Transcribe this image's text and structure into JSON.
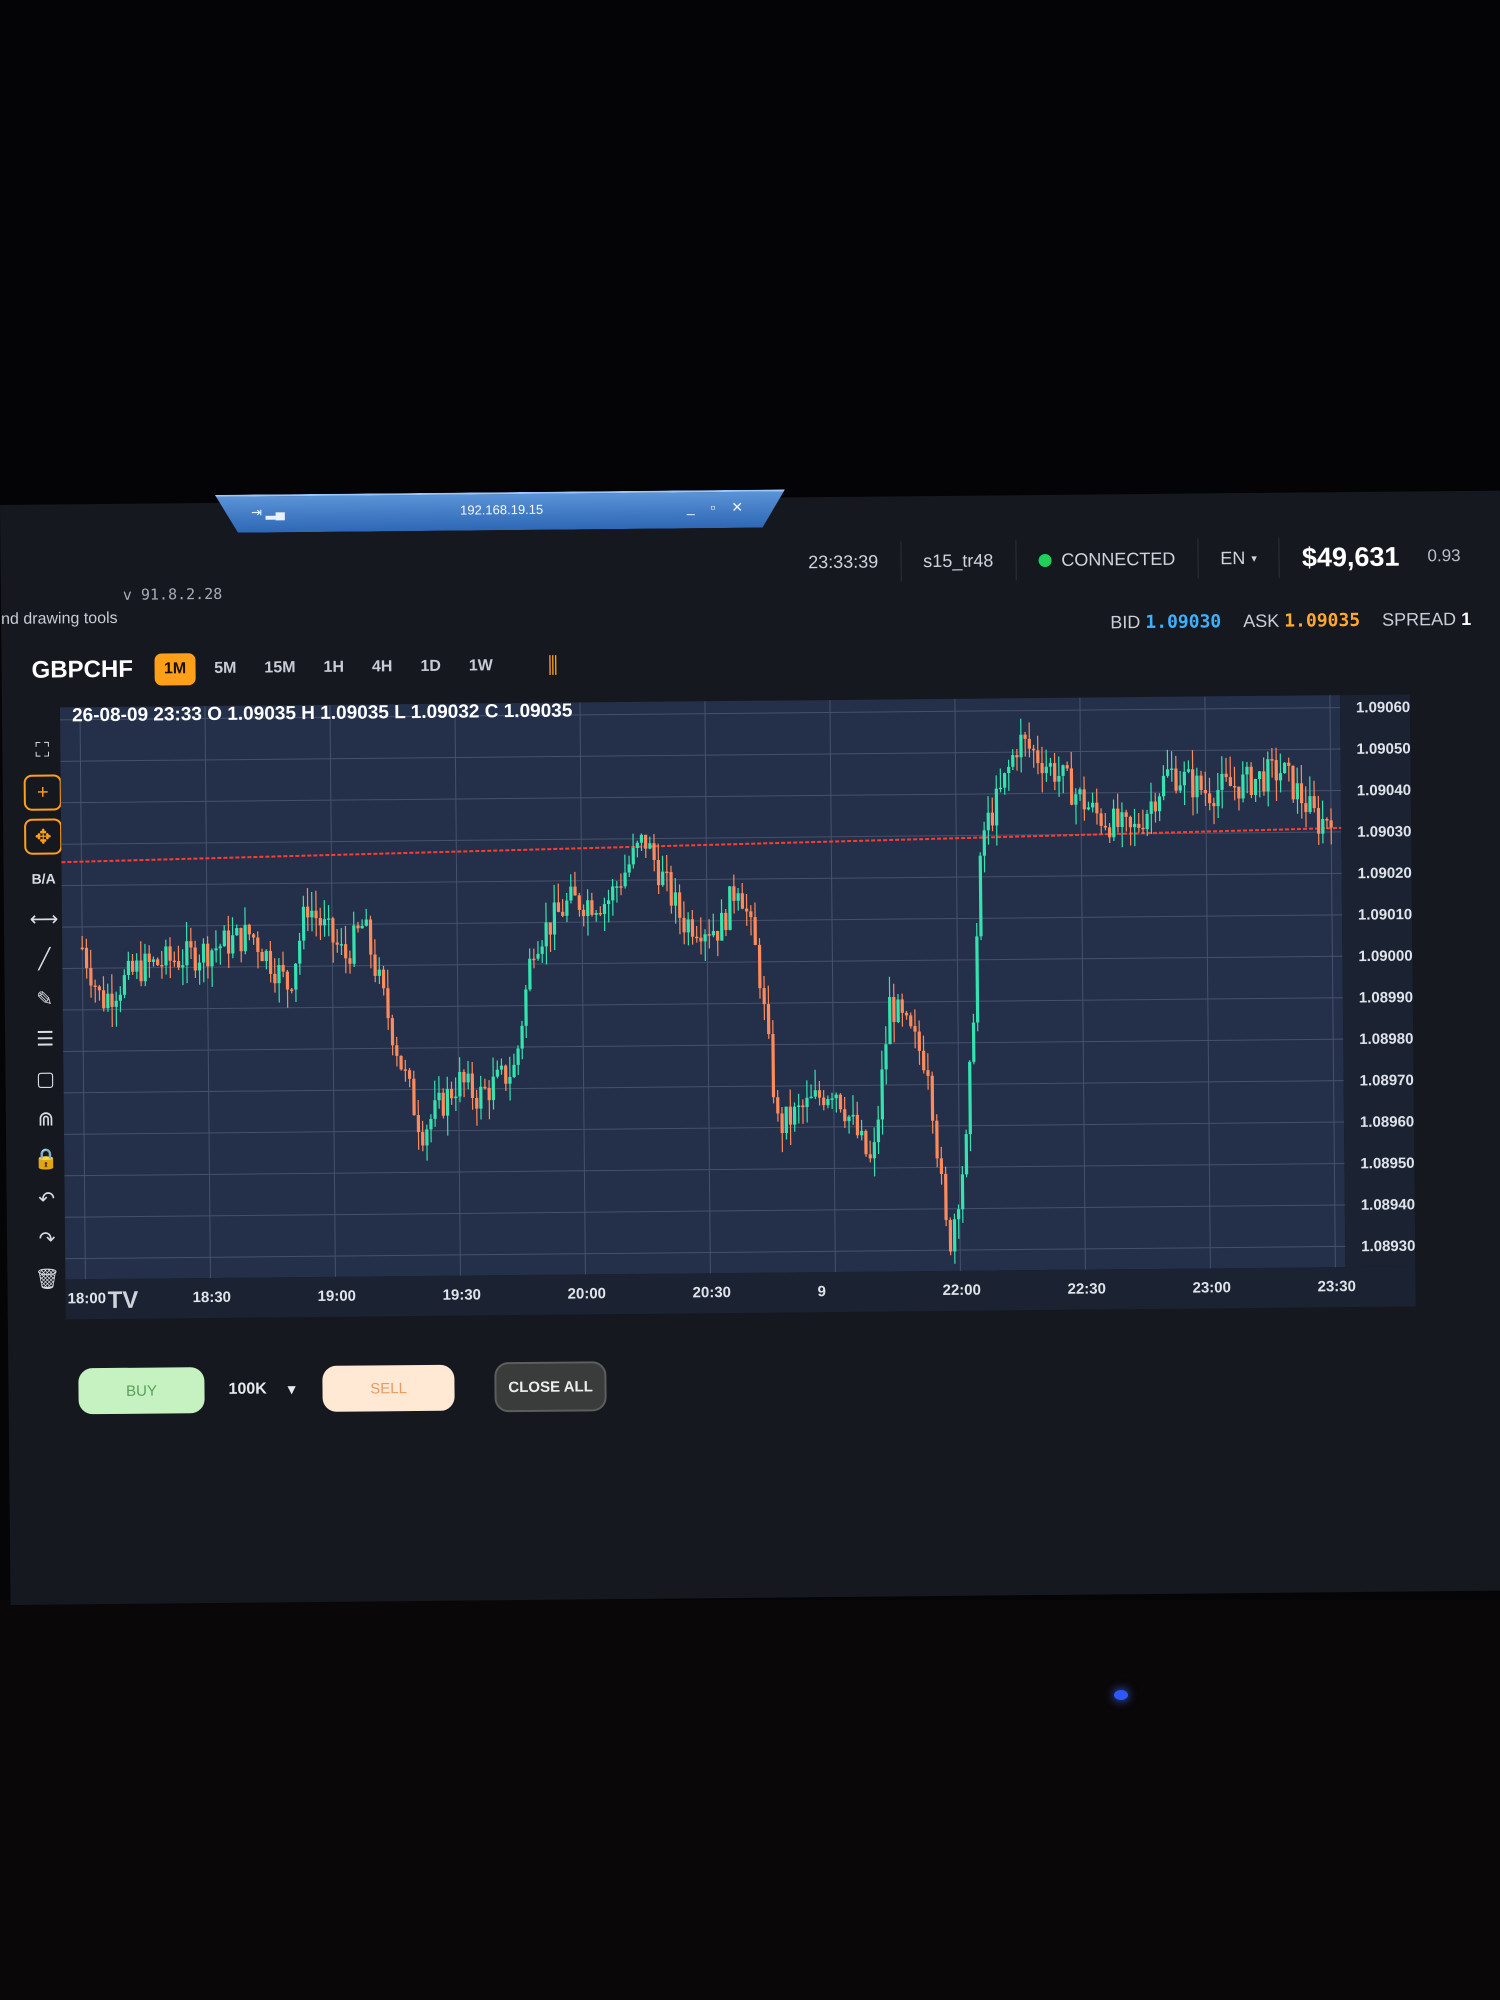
{
  "rdp": {
    "host": "192.168.19.15",
    "signal_icon": "signal-icon",
    "controls": "_ ▫ ✕"
  },
  "app": {
    "version": "v 91.8.2.28",
    "hint": "nd drawing tools"
  },
  "topbar": {
    "time": "23:33:39",
    "account": "s15_tr48",
    "status": "CONNECTED",
    "status_color": "#1fd15a",
    "language": "EN",
    "balance": "$49,631",
    "change": "0.93"
  },
  "quote": {
    "bid_label": "BID",
    "bid": "1.09030",
    "ask_label": "ASK",
    "ask": "1.09035",
    "spread_label": "SPREAD",
    "spread": "1",
    "bid_color": "#3db0ff",
    "ask_color": "#ffa82e"
  },
  "symbol": "GBPCHF",
  "timeframes": [
    "1M",
    "5M",
    "15M",
    "1H",
    "4H",
    "1D",
    "1W"
  ],
  "active_timeframe": "1M",
  "chart_data": {
    "type": "candlestick",
    "ohlc_readout": "26-08-09 23:33 O 1.09035 H 1.09035 L 1.09032 C 1.09035",
    "y_ticks": [
      "1.09060",
      "1.09050",
      "1.09040",
      "1.09030",
      "1.09020",
      "1.09010",
      "1.09000",
      "1.08990",
      "1.08980",
      "1.08970",
      "1.08960",
      "1.08950",
      "1.08940",
      "1.08930"
    ],
    "ylim": [
      1.08925,
      1.09063
    ],
    "x_ticks": [
      "18:00",
      "18:30",
      "19:00",
      "19:30",
      "20:00",
      "20:30",
      "9",
      "22:00",
      "22:30",
      "23:00",
      "23:30"
    ],
    "reference_line": 1.0903,
    "colors": {
      "up": "#34e3b0",
      "down": "#ff8a5c",
      "reference": "#ff3b30",
      "grid": "#46506a",
      "bg": "#243049"
    },
    "segments": [
      {
        "time": "18:00",
        "close": 1.09005
      },
      {
        "time": "18:05",
        "close": 1.08992
      },
      {
        "time": "18:15",
        "close": 1.09
      },
      {
        "time": "18:30",
        "close": 1.09003
      },
      {
        "time": "18:45",
        "close": 1.09008
      },
      {
        "time": "18:55",
        "close": 1.08995
      },
      {
        "time": "19:00",
        "close": 1.09015
      },
      {
        "time": "19:10",
        "close": 1.09002
      },
      {
        "time": "19:15",
        "close": 1.0901
      },
      {
        "time": "19:25",
        "close": 1.08975
      },
      {
        "time": "19:30",
        "close": 1.0896
      },
      {
        "time": "19:40",
        "close": 1.08972
      },
      {
        "time": "19:45",
        "close": 1.08968
      },
      {
        "time": "19:55",
        "close": 1.08975
      },
      {
        "time": "20:00",
        "close": 1.09005
      },
      {
        "time": "20:10",
        "close": 1.09015
      },
      {
        "time": "20:20",
        "close": 1.09015
      },
      {
        "time": "20:30",
        "close": 1.0903
      },
      {
        "time": "20:40",
        "close": 1.0901
      },
      {
        "time": "20:50",
        "close": 1.09008
      },
      {
        "time": "20:55",
        "close": 1.0902
      },
      {
        "time": "21:00",
        "close": 1.09
      },
      {
        "time": "21:05",
        "close": 1.0896
      },
      {
        "time": "21:20",
        "close": 1.0897
      },
      {
        "time": "21:30",
        "close": 1.0895
      },
      {
        "time": "21:35",
        "close": 1.0899
      },
      {
        "time": "21:45",
        "close": 1.08975
      },
      {
        "time": "21:50",
        "close": 1.0893
      },
      {
        "time": "21:55",
        "close": 1.08955
      },
      {
        "time": "22:00",
        "close": 1.0903
      },
      {
        "time": "22:05",
        "close": 1.0904
      },
      {
        "time": "22:10",
        "close": 1.09053
      },
      {
        "time": "22:20",
        "close": 1.09045
      },
      {
        "time": "22:30",
        "close": 1.09035
      },
      {
        "time": "22:40",
        "close": 1.0903
      },
      {
        "time": "22:50",
        "close": 1.09045
      },
      {
        "time": "23:00",
        "close": 1.0904
      },
      {
        "time": "23:10",
        "close": 1.09042
      },
      {
        "time": "23:20",
        "close": 1.09045
      },
      {
        "time": "23:30",
        "close": 1.09032
      },
      {
        "time": "23:33",
        "close": 1.09035
      }
    ]
  },
  "tools": [
    {
      "name": "fullscreen-icon",
      "glyph": "⛶"
    },
    {
      "name": "crosshair-icon",
      "glyph": "+"
    },
    {
      "name": "move-icon",
      "glyph": "✥"
    },
    {
      "name": "bid-ask-toggle",
      "glyph": "B/A"
    },
    {
      "name": "horizontal-line-icon",
      "glyph": "⟷"
    },
    {
      "name": "trend-line-icon",
      "glyph": "╱"
    },
    {
      "name": "pencil-icon",
      "glyph": "✎"
    },
    {
      "name": "fibonacci-icon",
      "glyph": "☰"
    },
    {
      "name": "rectangle-icon",
      "glyph": "▢"
    },
    {
      "name": "magnet-icon",
      "glyph": "⋒"
    },
    {
      "name": "lock-icon",
      "glyph": "🔒"
    },
    {
      "name": "undo-icon",
      "glyph": "↶"
    },
    {
      "name": "redo-icon",
      "glyph": "↷"
    },
    {
      "name": "trash-icon",
      "glyph": "🗑"
    }
  ],
  "tv_logo": "TV",
  "trade": {
    "buy": "BUY",
    "lot": "100K",
    "sell": "SELL",
    "close_all": "CLOSE ALL"
  }
}
